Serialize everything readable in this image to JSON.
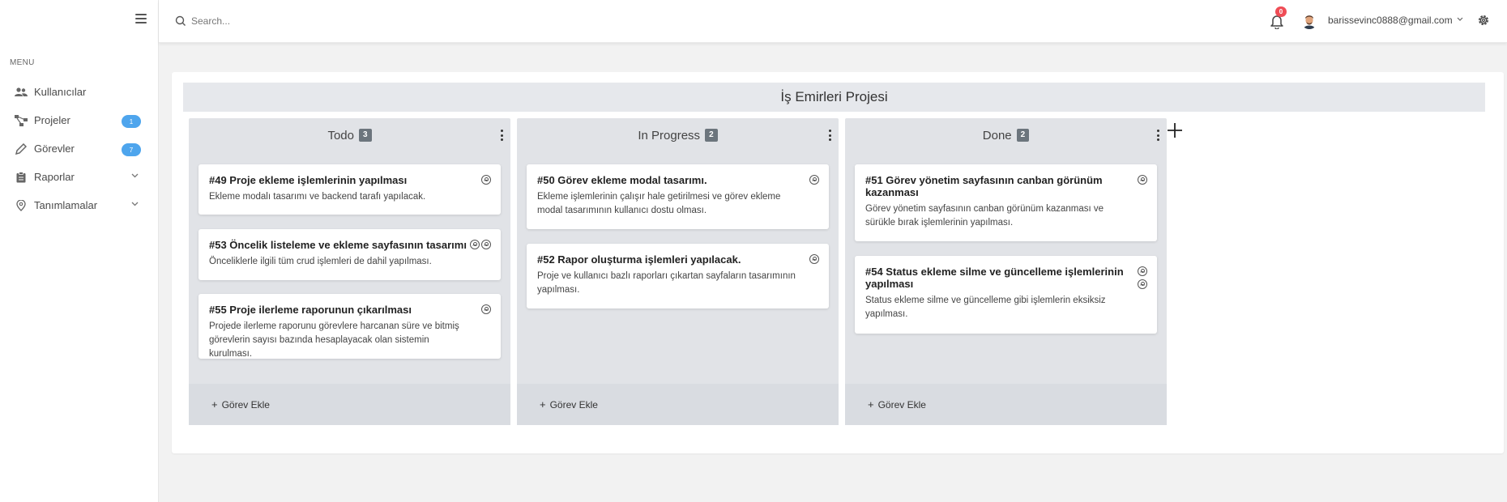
{
  "sidebar": {
    "menu_title": "MENU",
    "items": [
      {
        "label": "Kullanıcılar",
        "icon": "users-icon"
      },
      {
        "label": "Projeler",
        "icon": "project-tree-icon",
        "badge": "1"
      },
      {
        "label": "Görevler",
        "icon": "pencil-icon",
        "badge": "7"
      },
      {
        "label": "Raporlar",
        "icon": "clipboard-icon",
        "chevron": true
      },
      {
        "label": "Tanımlamalar",
        "icon": "location-pin-icon",
        "chevron": true
      }
    ]
  },
  "topbar": {
    "search_placeholder": "Search...",
    "notification_count": "0",
    "user_email": "barissevinc0888@gmail.com"
  },
  "board": {
    "project_title": "İş Emirleri Projesi",
    "add_task_label": "Görev Ekle",
    "columns": [
      {
        "name": "Todo",
        "count": "3",
        "tasks": [
          {
            "title": "#49 Proje ekleme işlemlerinin yapılması",
            "description": "Ekleme modalı tasarımı ve backend tarafı yapılacak.",
            "assignees": 1
          },
          {
            "title": "#53 Öncelik listeleme ve ekleme sayfasının tasarımı",
            "description": "Önceliklerle ilgili tüm crud işlemleri de dahil yapılması.",
            "assignees": 2
          },
          {
            "title": "#55 Proje ilerleme raporunun çıkarılması",
            "description": "Projede ilerleme raporunu görevlere harcanan süre ve bitmiş görevlerin sayısı bazında hesaplayacak olan sistemin kurulması.",
            "assignees": 1
          }
        ]
      },
      {
        "name": "In Progress",
        "count": "2",
        "tasks": [
          {
            "title": "#50 Görev ekleme modal tasarımı.",
            "description": "Ekleme işlemlerinin çalışır hale getirilmesi ve görev ekleme modal tasarımının kullanıcı dostu olması.",
            "assignees": 1
          },
          {
            "title": "#52 Rapor oluşturma işlemleri yapılacak.",
            "description": "Proje ve kullanıcı bazlı raporları çıkartan sayfaların tasarımının yapılması.",
            "assignees": 1
          }
        ]
      },
      {
        "name": "Done",
        "count": "2",
        "tasks": [
          {
            "title": "#51 Görev yönetim sayfasının canban görünüm kazanması",
            "description": "Görev yönetim sayfasının canban görünüm kazanması ve sürükle bırak işlemlerinin yapılması.",
            "assignees": 1
          },
          {
            "title": "#54 Status ekleme silme ve güncelleme işlemlerinin yapılması",
            "description": "Status ekleme silme ve güncelleme gibi işlemlerin eksiksiz yapılması.",
            "assignees": 2
          }
        ]
      }
    ]
  },
  "colors": {
    "badge_blue": "#4ea5ed",
    "notification_red": "#ef4d56",
    "column_bg": "#e1e3e7",
    "count_badge": "#6c757d"
  }
}
